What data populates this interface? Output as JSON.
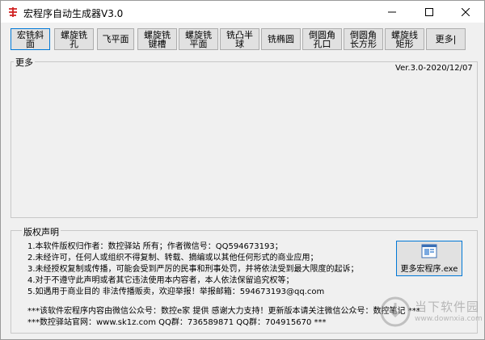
{
  "window": {
    "title": "宏程序自动生成器V3.0"
  },
  "toolbar": {
    "buttons": [
      "宏铣斜面",
      "螺旋铣孔",
      "飞平面",
      "螺旋铣 键槽",
      "螺旋铣 平面",
      "铣凸半球",
      "铣椭圆",
      "倒圆角 孔口",
      "倒圆角 长方形",
      "螺旋线 矩形",
      "更多|"
    ]
  },
  "more_panel": {
    "label": "更多",
    "version": "Ver.3.0-2020/12/07"
  },
  "copyright": {
    "label": "版权声明",
    "lines": [
      "1.本软件版权归作者：数控驿站 所有；作者微信号：QQ594673193；",
      "2.未经许可，任何人或组织不得复制、转载、摘编或以其他任何形式的商业应用；",
      "3.未经授权复制或传播，可能会受到严厉的民事和刑事处罚，并将依法受到最大限度的起诉；",
      "4.对于不遵守此声明或者其它违法使用本内容者，本人依法保留追究权等；",
      "5.如遇用于商业目的 非法传播贩卖，欢迎举报！举报邮箱：594673193@qq.com"
    ],
    "footer1": "***该软件宏程序内容由微信公众号：数控e家 提供 感谢大力支持！更新版本请关注微信公众号：数控笔记 ***",
    "footer2": "***数控驿站官网：www.sk1z.com   QQ群：736589871   QQ群：704915670 ***"
  },
  "exe_button": {
    "label": "更多宏程序.exe"
  },
  "watermark": {
    "title": "当下软件园",
    "url": "www.downxia.com"
  },
  "colors": {
    "accent": "#0078d7",
    "window_bg": "#f0f0f0",
    "button_bg": "#e1e1e1"
  }
}
